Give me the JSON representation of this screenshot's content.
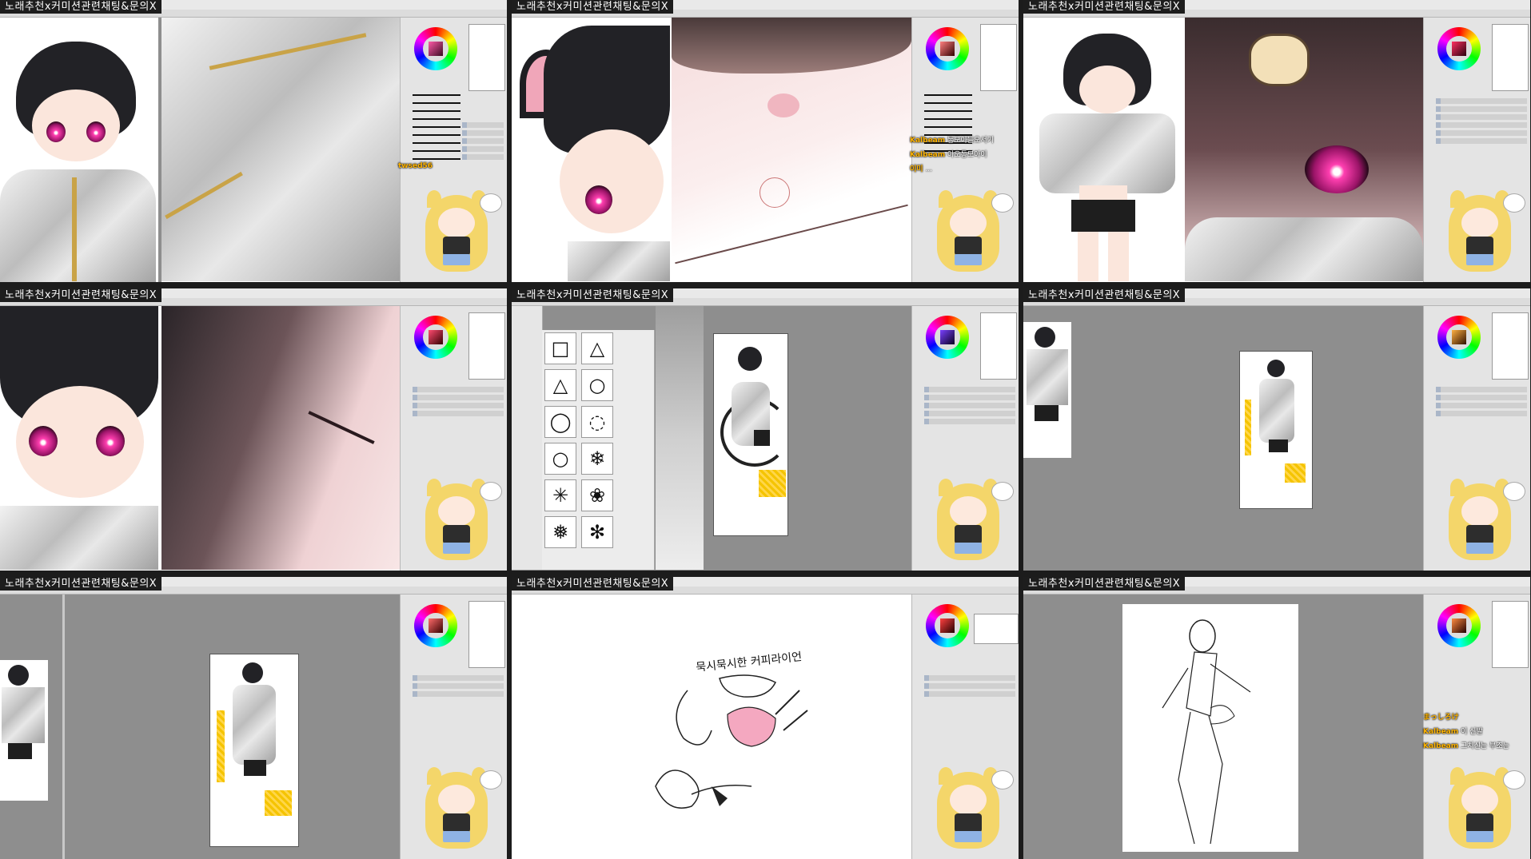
{
  "window_title": "노래추천x커미션관련채팅&문의X",
  "panels": [
    {
      "id": "p1",
      "view": "character-closeup-jacket",
      "chat": [
        {
          "user": "twsed56",
          "text": ""
        }
      ]
    },
    {
      "id": "p2",
      "view": "face-closeup-pink",
      "chat": [
        {
          "user": "Kalbeam",
          "text": "통모아들오서기"
        },
        {
          "user": "Kalbeam",
          "text": "아오통모아이"
        },
        {
          "user": "이미",
          "text": "..."
        }
      ]
    },
    {
      "id": "p3",
      "view": "full-character-hairpin"
    },
    {
      "id": "p4",
      "view": "face-hair-closeup"
    },
    {
      "id": "p5",
      "view": "brush-shapes-composition"
    },
    {
      "id": "p6",
      "view": "composition-small"
    },
    {
      "id": "p7",
      "view": "composition-medium"
    },
    {
      "id": "p8",
      "view": "sketch-doodle",
      "sketch_text": "묵시묵시한 커피라이언"
    },
    {
      "id": "p9",
      "view": "pose-sketch",
      "chat": [
        {
          "user": "まっしろけ",
          "text": ""
        },
        {
          "user": "Kalbeam",
          "text": "이 신발"
        },
        {
          "user": "Kalbeam",
          "text": "그치신는 부조는"
        }
      ]
    }
  ],
  "colors": {
    "title_bg": "#1d1d1d",
    "accent_pink": "#ff3fb0",
    "gold": "#c9a347",
    "panel_gray": "#8e8e8e"
  }
}
